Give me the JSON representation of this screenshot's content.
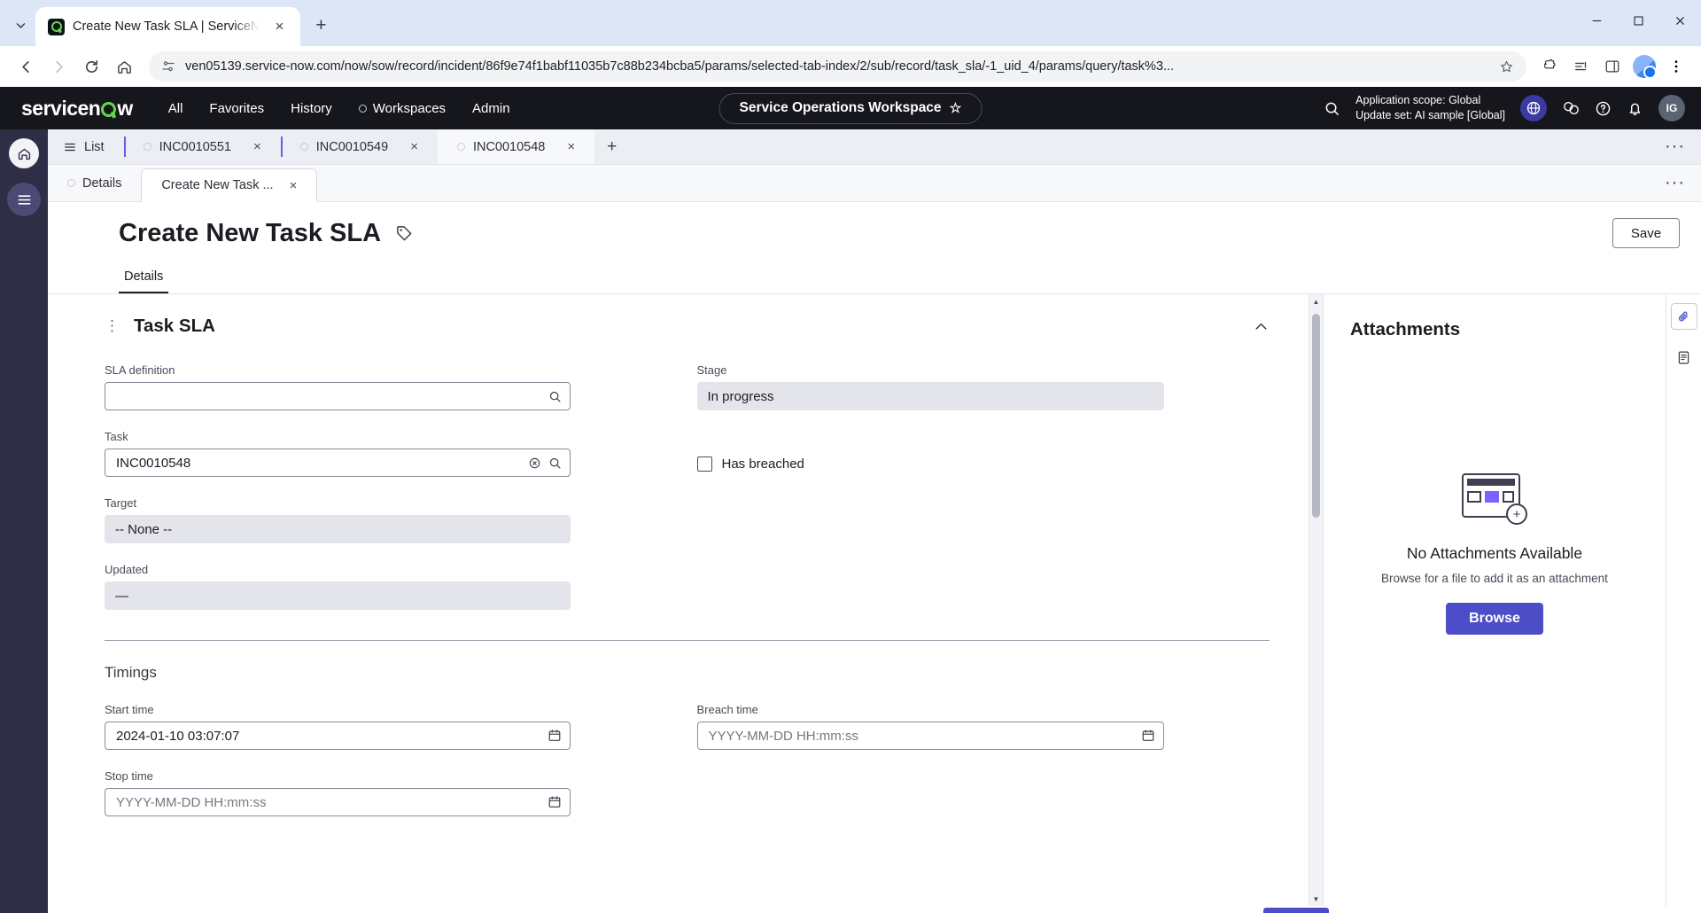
{
  "browser": {
    "tab": {
      "title": "Create New Task SLA | ServiceN",
      "favicon": "servicenow-favicon"
    },
    "new_tab_label": "+",
    "close_label": "×",
    "url": "ven05139.service-now.com/now/sow/record/incident/86f9e74f1babf11035b7c88b234bcba5/params/selected-tab-index/2/sub/record/task_sla/-1_uid_4/params/query/task%3...",
    "window_controls": {
      "minimize": "—",
      "maximize": "□",
      "close": "✕"
    }
  },
  "header": {
    "logo": "servicenow",
    "nav": [
      {
        "label": "All",
        "icon": "none"
      },
      {
        "label": "Favorites",
        "icon": "none"
      },
      {
        "label": "History",
        "icon": "none"
      },
      {
        "label": "Workspaces",
        "icon": "circle-icon"
      },
      {
        "label": "Admin",
        "icon": "none"
      }
    ],
    "workspace_pill": {
      "label": "Service Operations Workspace",
      "star": "☆"
    },
    "scope_line1": "Application scope: Global",
    "scope_line2": "Update set: AI sample [Global]",
    "icons": [
      "search-icon",
      "globe-icon",
      "connect-icon",
      "help-icon",
      "bell-icon"
    ],
    "avatar_initials": "IG"
  },
  "record_tabs": {
    "list_label": "List",
    "tabs": [
      {
        "label": "INC0010551",
        "active": false
      },
      {
        "label": "INC0010549",
        "active": false
      },
      {
        "label": "INC0010548",
        "active": true
      }
    ],
    "add_label": "+",
    "close_label": "×",
    "more_label": "···"
  },
  "sub_tabs": {
    "tabs": [
      {
        "label": "Details",
        "active": false
      },
      {
        "label": "Create New Task ...",
        "active": true
      }
    ],
    "close_label": "×",
    "more_label": "···"
  },
  "page": {
    "title": "Create New Task SLA",
    "tag_icon": "tag-icon",
    "save_label": "Save",
    "detail_tab_label": "Details"
  },
  "form": {
    "section_title": "Task SLA",
    "fields": {
      "sla_definition": {
        "label": "SLA definition",
        "value": "",
        "placeholder": "",
        "icon": "search-icon"
      },
      "stage": {
        "label": "Stage",
        "value": "In progress",
        "readonly": true
      },
      "task": {
        "label": "Task",
        "value": "INC0010548",
        "icons": [
          "clear-icon",
          "search-icon"
        ]
      },
      "has_breached": {
        "label": "Has breached",
        "checked": false
      },
      "target": {
        "label": "Target",
        "value": "-- None --",
        "readonly": true
      },
      "updated": {
        "label": "Updated",
        "value": "—",
        "readonly": true
      }
    },
    "timings": {
      "title": "Timings",
      "start_time": {
        "label": "Start time",
        "value": "2024-01-10 03:07:07",
        "icon": "calendar-icon"
      },
      "breach_time": {
        "label": "Breach time",
        "value": "",
        "placeholder": "YYYY-MM-DD HH:mm:ss",
        "icon": "calendar-icon"
      },
      "stop_time": {
        "label": "Stop time",
        "value": "",
        "placeholder": "YYYY-MM-DD HH:mm:ss",
        "icon": "calendar-icon"
      }
    }
  },
  "attachments": {
    "title": "Attachments",
    "empty_title": "No Attachments Available",
    "empty_sub": "Browse for a file to add it as an attachment",
    "browse_label": "Browse"
  },
  "colors": {
    "brand_green": "#62d84e",
    "header_dark": "#16161d",
    "rail_purple": "#2e2e46",
    "accent_purple": "#4d4dc8",
    "readonly_grey": "#e4e5ea"
  }
}
